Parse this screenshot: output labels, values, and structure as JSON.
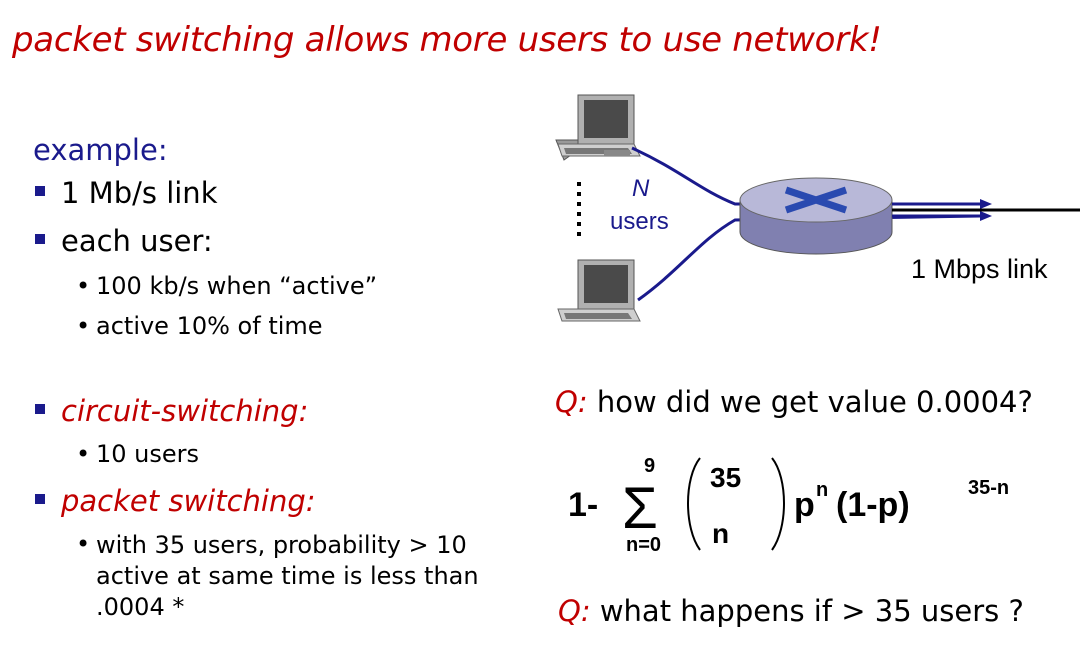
{
  "title": "packet switching allows more users to use network!",
  "example_label": "example:",
  "bullets": {
    "link": "1 Mb/s link",
    "each_user": "each user:",
    "each_user_subs": [
      "100 kb/s when “active”",
      "active 10% of time"
    ],
    "circuit": "circuit-switching:",
    "circuit_subs": [
      "10 users"
    ],
    "packet": "packet switching:",
    "packet_note": "with 35 users, probability > 10 active at same time is less than .0004 *"
  },
  "diagram": {
    "n_label": "N",
    "users_label": "users",
    "link_label": "1 Mbps link",
    "colors": {
      "link": "#1a1a8c",
      "router_top": "#b8b8d8",
      "router_side": "#8080b0"
    },
    "icons": [
      "computer-icon",
      "computer-icon",
      "router-icon"
    ]
  },
  "question1": {
    "q": "Q:",
    "text": " how did we get value 0.0004?"
  },
  "formula": {
    "one_minus": "1-",
    "sum_top": "9",
    "sum_bottom": "n=0",
    "binom_top": "35",
    "binom_bottom": "n",
    "p": "p",
    "n_exp": "n",
    "one_minus_p": "(1-p)",
    "exp2": "35-n"
  },
  "question2": {
    "q": "Q:",
    "text": " what happens if > 35 users ?"
  }
}
